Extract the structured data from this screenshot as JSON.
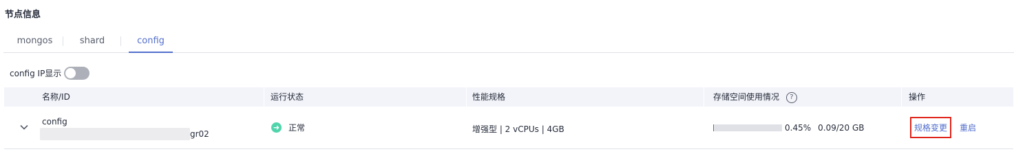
{
  "section": {
    "title": "节点信息"
  },
  "tabs": [
    {
      "label": "mongos",
      "active": false
    },
    {
      "label": "shard",
      "active": false
    },
    {
      "label": "config",
      "active": true
    }
  ],
  "ip_toggle": {
    "label": "config IP显示",
    "on": false
  },
  "table": {
    "columns": [
      "名称/ID",
      "运行状态",
      "性能规格",
      "存储空间使用情况",
      "操作"
    ],
    "rows": [
      {
        "name": "config",
        "id_visible_suffix": "gr02",
        "status": "正常",
        "status_icon": "arrow-right-circle-icon",
        "spec": "增强型 | 2 vCPUs | 4GB",
        "storage_percent": 0.45,
        "storage_percent_text": "0.45%",
        "storage_usage": "0.09/20 GB",
        "actions": [
          "规格变更",
          "重启"
        ]
      }
    ]
  },
  "colors": {
    "accent": "#526ecc",
    "status_ok": "#50d4ab",
    "highlight_box": "#e0231a",
    "header_bg": "#f3f4f9"
  }
}
